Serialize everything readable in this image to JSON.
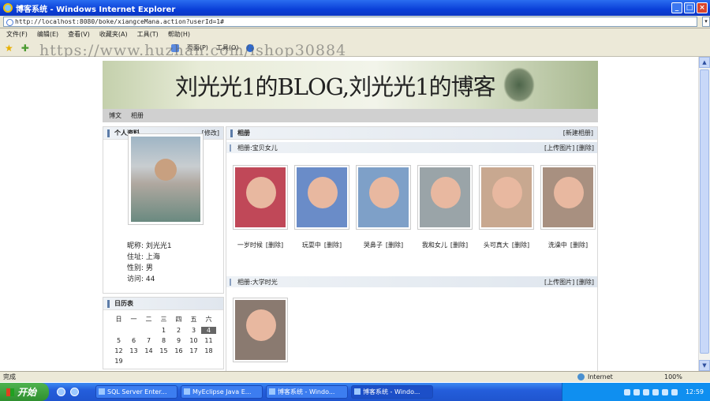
{
  "window": {
    "title": "博客系统 - Windows Internet Explorer",
    "buttons": [
      "_",
      "□",
      "×"
    ]
  },
  "address": {
    "url": "http://localhost:8080/boke/xiangceMana.action?userId=1#",
    "go": "▾"
  },
  "menu": [
    "文件(F)",
    "编辑(E)",
    "查看(V)",
    "收藏夹(A)",
    "工具(T)",
    "帮助(H)"
  ],
  "toolbar": {
    "page": "页面(P)",
    "tools": "工具(O)"
  },
  "watermark": "https://www.huzhan.com/ishop30884",
  "blog": {
    "banner_title": "刘光光1的BLOG,刘光光1的博客",
    "nav": [
      "博文",
      "相册"
    ],
    "profile": {
      "heading": "个人资料",
      "edit": "[修改]",
      "nickname": "昵称: 刘光光1",
      "address": "住址: 上海",
      "gender": "性别: 男",
      "visits": "访问: 44"
    },
    "calendar": {
      "heading": "日历表",
      "weekdays": [
        "日",
        "一",
        "二",
        "三",
        "四",
        "五",
        "六"
      ],
      "days": [
        "",
        "",
        "",
        "1",
        "2",
        "3",
        "4",
        "5",
        "6",
        "7",
        "8",
        "9",
        "10",
        "11",
        "12",
        "13",
        "14",
        "15",
        "16",
        "17",
        "18",
        "19"
      ],
      "today": "4"
    },
    "albums_heading": "相册",
    "new_album": "[新建相册]",
    "albums": [
      {
        "title": "相册:宝贝女儿",
        "actions": "[上传图片] [删除]",
        "photos": [
          {
            "caption": "一岁时候",
            "delete": "[删除]",
            "bg": "#c04858"
          },
          {
            "caption": "玩耍中",
            "delete": "[删除]",
            "bg": "#6a8cc8"
          },
          {
            "caption": "哭鼻子",
            "delete": "[删除]",
            "bg": "#7ea0c8"
          },
          {
            "caption": "我和女儿",
            "delete": "[删除]",
            "bg": "#9aa4a8"
          },
          {
            "caption": "头可真大",
            "delete": "[删除]",
            "bg": "#c8a890"
          },
          {
            "caption": "洗澡中",
            "delete": "[删除]",
            "bg": "#a89080"
          }
        ]
      },
      {
        "title": "相册:大学时光",
        "actions": "[上传图片] [删除]",
        "photos": [
          {
            "caption": "",
            "bg": "#8a7a70"
          }
        ]
      }
    ]
  },
  "status": {
    "text": "完成",
    "zone": "Internet",
    "zoom": "100%"
  },
  "taskbar": {
    "start": "开始",
    "tasks": [
      "SQL Server Enter...",
      "MyEclipse Java E...",
      "博客系统 - Windo...",
      "博客系统 - Windo..."
    ],
    "clock": "12:59"
  }
}
